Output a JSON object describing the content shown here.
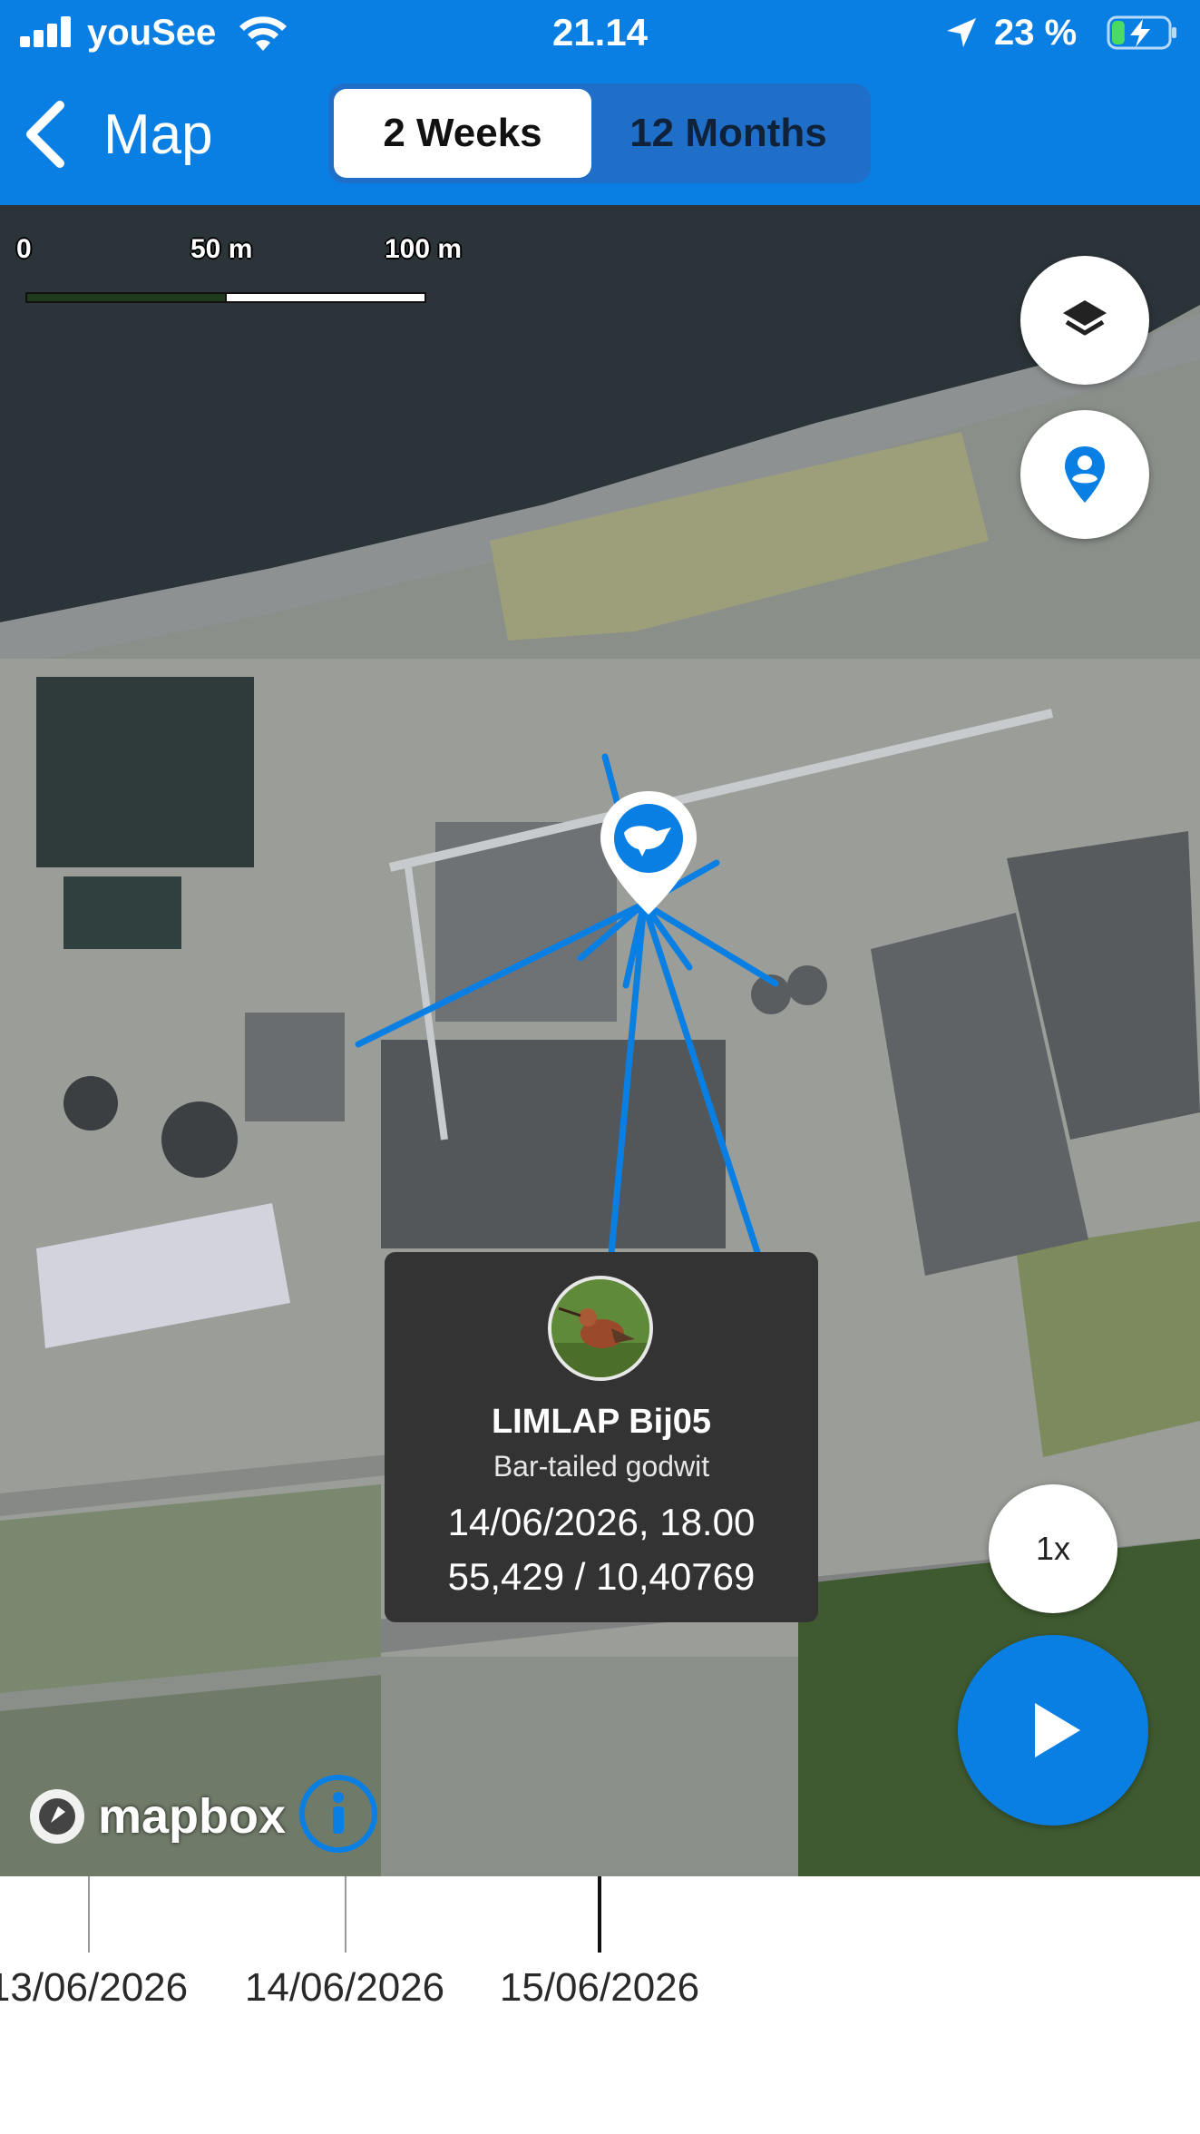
{
  "status_bar": {
    "carrier": "youSee",
    "time": "21.14",
    "battery_percent": "23 %",
    "battery_level": 0.23
  },
  "nav": {
    "back_label": "Map",
    "segments": [
      {
        "label": "2 Weeks",
        "active": true
      },
      {
        "label": "12 Months",
        "active": false
      }
    ]
  },
  "map": {
    "scale": {
      "labels": [
        "0",
        "50 m",
        "100 m"
      ]
    },
    "layers_button": "layers-icon",
    "locate_button": "location-pin-icon",
    "speed_label": "1x",
    "attribution": "mapbox",
    "track_color": "#0a7fe3"
  },
  "popup": {
    "name": "LIMLAP Bij05",
    "species": "Bar-tailed godwit",
    "datetime": "14/06/2026, 18.00",
    "coordinates": "55,429 / 10,40769"
  },
  "timeline": {
    "ticks": [
      {
        "label": "13/06/2026",
        "current": false
      },
      {
        "label": "14/06/2026",
        "current": false
      },
      {
        "label": "15/06/2026",
        "current": true
      }
    ]
  },
  "colors": {
    "accent": "#0a7fe3",
    "popup_bg": "#333333"
  }
}
